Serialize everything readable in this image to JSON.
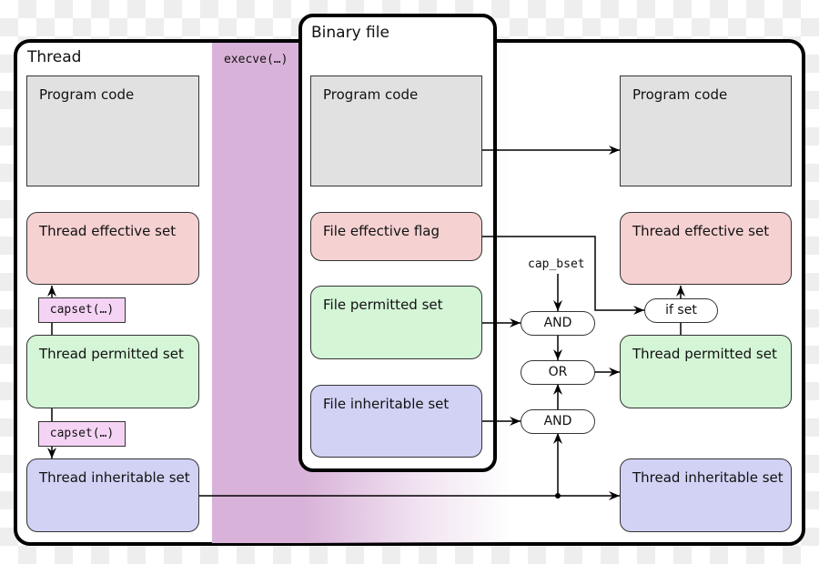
{
  "thread": {
    "title": "Thread",
    "program_code": "Program code",
    "effective": "Thread effective set",
    "permitted": "Thread permitted set",
    "inheritable": "Thread inheritable set",
    "capset_upper": "capset(…)",
    "capset_lower": "capset(…)"
  },
  "execve": "execve(…)",
  "binary": {
    "title": "Binary file",
    "program_code": "Program code",
    "effective_flag": "File effective flag",
    "permitted": "File permitted set",
    "inheritable": "File inheritable set"
  },
  "result": {
    "program_code": "Program code",
    "effective": "Thread effective set",
    "permitted": "Thread permitted set",
    "inheritable": "Thread inheritable set"
  },
  "ops": {
    "cap_bset": "cap_bset",
    "and_top": "AND",
    "or": "OR",
    "and_bottom": "AND",
    "if_set": "if set"
  },
  "colors": {
    "effective": "#f5d1d1",
    "permitted": "#d4f5d6",
    "inheritable": "#d2d2f5",
    "code": "#e1e1e1",
    "capset": "#f5d3f5",
    "execve_band": "#d8b2d8"
  }
}
